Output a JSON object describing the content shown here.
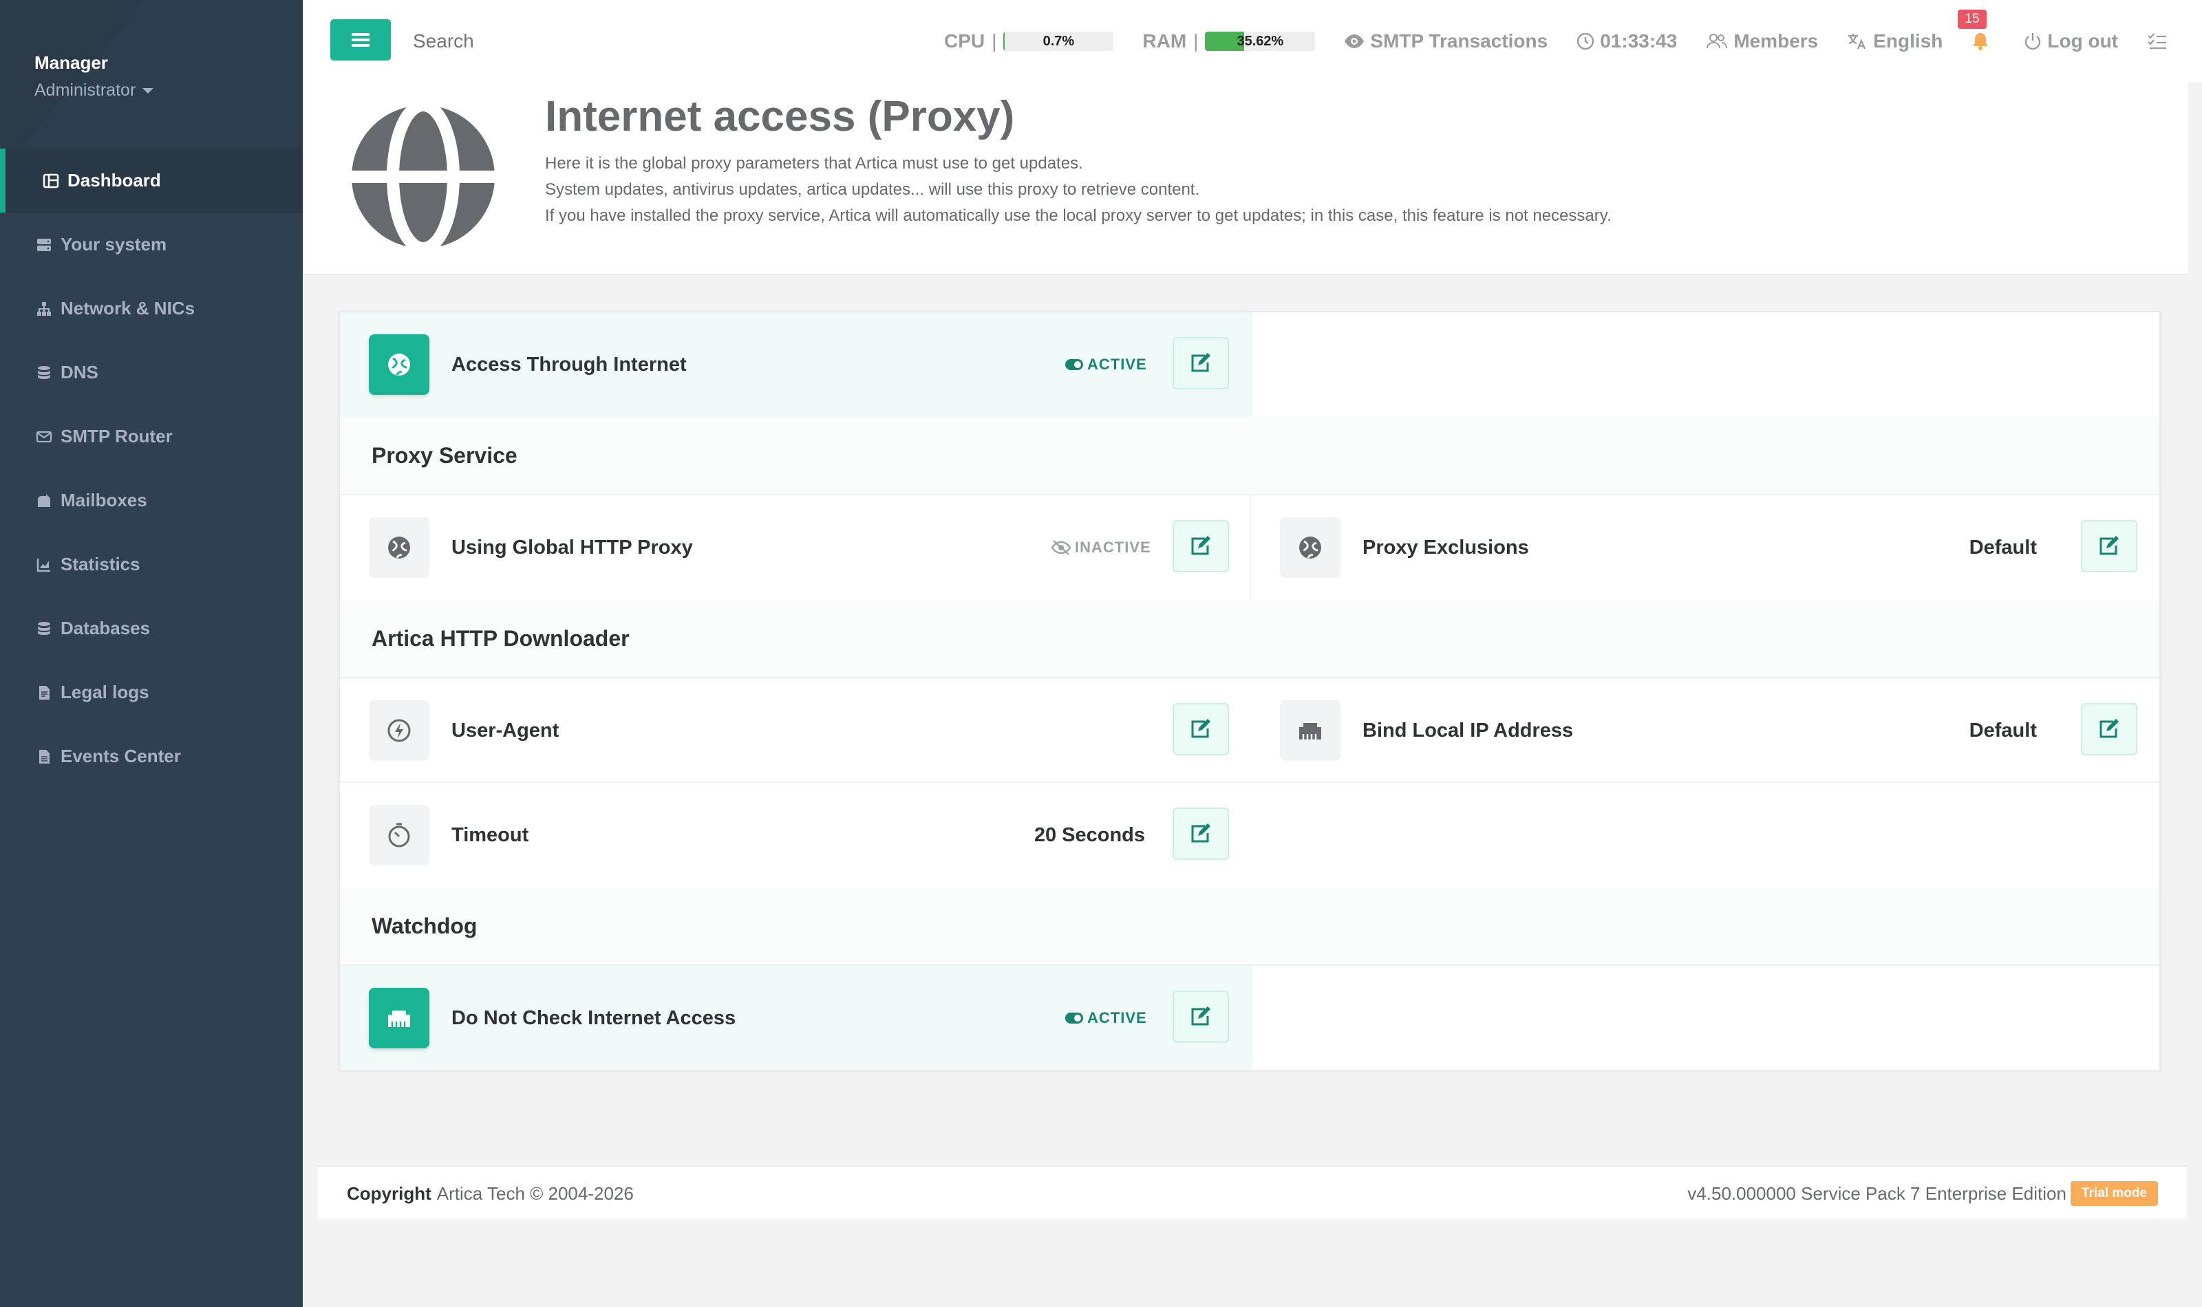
{
  "sidebar": {
    "profile": {
      "name": "Manager",
      "role": "Administrator"
    },
    "items": [
      {
        "label": "Dashboard",
        "icon": "dashboard-icon",
        "active": true
      },
      {
        "label": "Your system",
        "icon": "server-icon"
      },
      {
        "label": "Network & NICs",
        "icon": "network-icon"
      },
      {
        "label": "DNS",
        "icon": "database-icon"
      },
      {
        "label": "SMTP Router",
        "icon": "envelope-icon"
      },
      {
        "label": "Mailboxes",
        "icon": "mailbox-icon"
      },
      {
        "label": "Statistics",
        "icon": "chart-icon"
      },
      {
        "label": "Databases",
        "icon": "database-icon"
      },
      {
        "label": "Legal logs",
        "icon": "file-icon"
      },
      {
        "label": "Events Center",
        "icon": "document-icon"
      }
    ]
  },
  "topbar": {
    "search_placeholder": "Search",
    "cpu": {
      "label": "CPU",
      "value": "0.7%",
      "percent": 0.7
    },
    "ram": {
      "label": "RAM",
      "value": "35.62%",
      "percent": 35.62
    },
    "smtp_transactions": "SMTP Transactions",
    "clock": "01:33:43",
    "members": "Members",
    "language": "English",
    "notifications_count": "15",
    "logout": "Log out",
    "separator": "|"
  },
  "header": {
    "title": "Internet access (Proxy)",
    "description": [
      "Here it is the global proxy parameters that Artica must use to get updates.",
      "System updates, antivirus updates, artica updates... will use this proxy to retrieve content.",
      "If you have installed the proxy service, Artica will automatically use the local proxy server to get updates; in this case, this feature is not necessary."
    ]
  },
  "settings": {
    "access_through_internet": {
      "label": "Access Through Internet",
      "status": "ACTIVE"
    },
    "proxy_service": {
      "title": "Proxy Service",
      "global_http_proxy": {
        "label": "Using Global HTTP Proxy",
        "status": "INACTIVE"
      },
      "proxy_exclusions": {
        "label": "Proxy Exclusions",
        "value": "Default"
      }
    },
    "http_downloader": {
      "title": "Artica HTTP Downloader",
      "user_agent": {
        "label": "User-Agent"
      },
      "bind_local_ip": {
        "label": "Bind Local IP Address",
        "value": "Default"
      },
      "timeout": {
        "label": "Timeout",
        "value": "20 Seconds"
      }
    },
    "watchdog": {
      "title": "Watchdog",
      "do_not_check": {
        "label": "Do Not Check Internet Access",
        "status": "ACTIVE"
      }
    }
  },
  "footer": {
    "copyright_label": "Copyright",
    "copyright_text": "Artica Tech © 2004-2026",
    "version": "v4.50.000000 Service Pack 7 Enterprise Edition",
    "trial_badge": "Trial mode"
  },
  "colors": {
    "accent": "#1ab394",
    "sidebar": "#2f4050",
    "active_status": "#18846f",
    "notification": "#ed5565",
    "trial": "#f8ac59"
  }
}
